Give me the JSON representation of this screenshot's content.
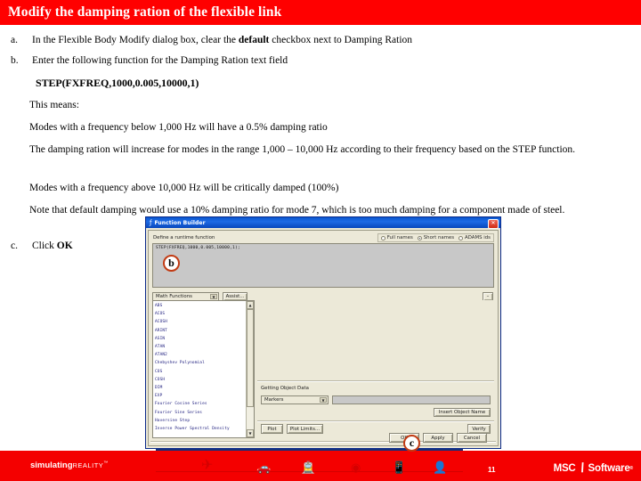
{
  "slide": {
    "title": "Modify the damping ration of the flexible link",
    "title_bg": "#FF0000",
    "title_color": "#FFFFFF"
  },
  "steps": [
    {
      "marker": "a.",
      "text_before": "In the Flexible Body Modify dialog box, clear the ",
      "bold": "default",
      "text_after": " checkbox next to Damping Ration"
    },
    {
      "marker": "b.",
      "text_before": "Enter the following function for the Damping Ration text field",
      "bold": "",
      "text_after": ""
    },
    {
      "marker": "c.",
      "text_before": "Click ",
      "bold": "OK",
      "text_after": ""
    }
  ],
  "code": "STEP(FXFREQ,1000,0.005,10000,1)",
  "paragraphs": [
    "This means:",
    "Modes with a frequency below 1,000 Hz will have a 0.5% damping ratio",
    "The damping ration will increase for modes in the range 1,000 – 10,000 Hz according to their frequency based on the STEP function.",
    "Modes with a frequency above 10,000 Hz will be critically damped (100%)",
    "Note that default damping would use a 10% damping ratio for mode 7, which is too much damping for a component made of steel."
  ],
  "callouts": [
    {
      "label": "b"
    },
    {
      "label": "c"
    }
  ],
  "dialog": {
    "title": "Function Builder",
    "title_icon": "function-icon",
    "close_label": "✕",
    "define_label": "Define a runtime function",
    "name_modes": [
      {
        "label": "Full names",
        "selected": false
      },
      {
        "label": "Short names",
        "selected": true
      },
      {
        "label": "ADAMS ids",
        "selected": false
      }
    ],
    "function_text": "STEP(FXFREQ,1000,0.005,10000,1);",
    "category_combo": "Math Functions",
    "assist_button": "Assist...",
    "expand_button": "–",
    "function_list": [
      "ABS",
      "ACOS",
      "ACOSH",
      "ARINT",
      "ASIN",
      "ATAN",
      "ATAN2",
      "Chebyshev Polynomial",
      "COS",
      "COSH",
      "DIM",
      "EXP",
      "Fourier Cosine Series",
      "Fourier Sine Series",
      "Haversine Step",
      "Inverse Power Spectral Density"
    ],
    "getting_object_data_label": "Getting Object Data",
    "object_combo": "Markers",
    "object_field_value": "",
    "insert_object_button": "Insert Object Name",
    "plot_button": "Plot",
    "plot_limits_button": "Plot Limits...",
    "verify_button": "Verify",
    "ok_button": "OK",
    "apply_button": "Apply",
    "cancel_button": "Cancel"
  },
  "footer": {
    "tagline_bold": "simulating",
    "tagline_thin": "REALITY",
    "tagline_tm": "™",
    "page_number": "11",
    "logo_msc": "MSC",
    "logo_slash": "\\",
    "logo_software": "Software",
    "logo_reg": "®",
    "icons": [
      "airplane-icon",
      "car-icon",
      "train-icon",
      "disc-icon",
      "phone-icon",
      "person-icon"
    ],
    "bg": "#F40000"
  }
}
